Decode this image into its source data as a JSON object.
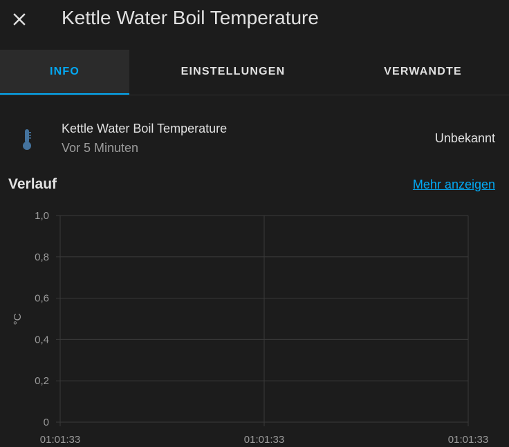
{
  "dialog": {
    "title": "Kettle Water Boil Temperature",
    "close_icon": "close-icon"
  },
  "tabs": [
    {
      "label": "INFO",
      "active": true
    },
    {
      "label": "EINSTELLUNGEN",
      "active": false
    },
    {
      "label": "VERWANDTE",
      "active": false
    }
  ],
  "entity": {
    "icon": "thermometer-icon",
    "name": "Kettle Water Boil Temperature",
    "last_changed": "Vor 5 Minuten",
    "state": "Unbekannt"
  },
  "history": {
    "title": "Verlauf",
    "more_link": "Mehr anzeigen"
  },
  "colors": {
    "background": "#1c1c1c",
    "accent": "#03a9f4",
    "icon": "#44739e",
    "text": "#e1e1e1",
    "secondary_text": "#9b9b9b",
    "grid": "#3a3a3a"
  },
  "chart_data": {
    "type": "line",
    "ylabel": "°C",
    "ylim": [
      0,
      1.0
    ],
    "y_ticks": [
      "0",
      "0,2",
      "0,4",
      "0,6",
      "0,8",
      "1,0"
    ],
    "x_ticks": [
      "01:01:33",
      "01:01:33",
      "01:01:33"
    ],
    "series": [],
    "grid": true
  }
}
